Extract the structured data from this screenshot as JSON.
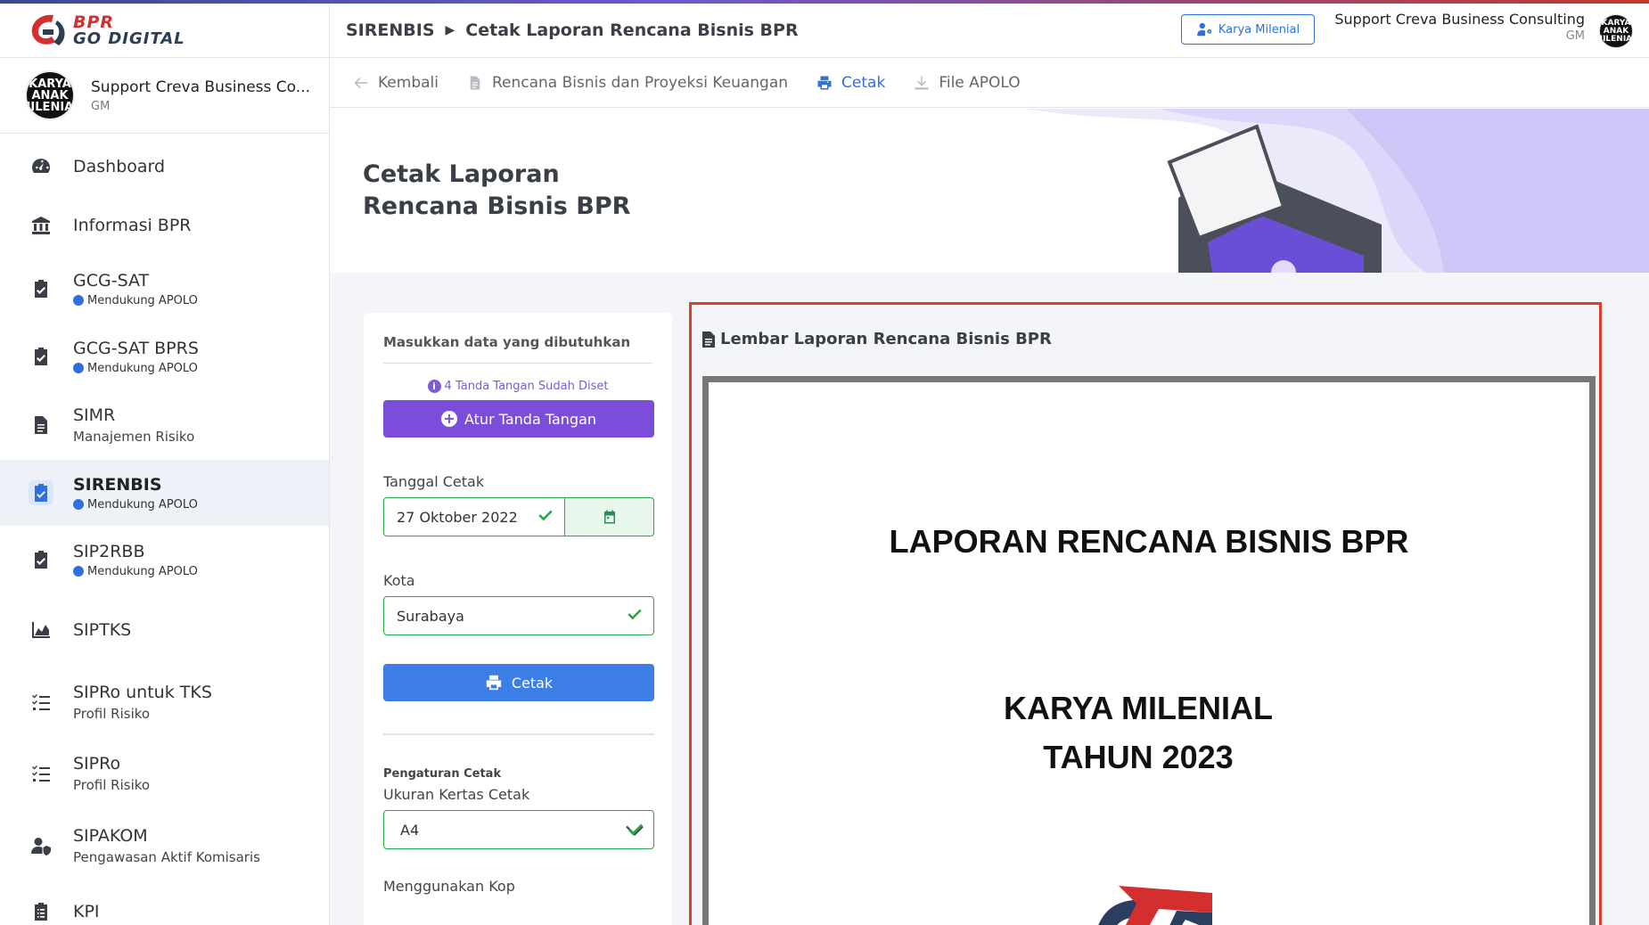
{
  "logo": {
    "line1": "BPR",
    "line2": "GO DIGITAL"
  },
  "user": {
    "name": "Support Creva Business Co...",
    "role": "GM",
    "avatar_text": "KARYA ANAK MILENIAL"
  },
  "menu": [
    {
      "label": "Dashboard",
      "sub": "",
      "icon": "dashboard-icon"
    },
    {
      "label": "Informasi BPR",
      "sub": "",
      "icon": "bank-icon"
    },
    {
      "label": "GCG-SAT",
      "sub": "Mendukung APOLO",
      "icon": "clipboard-check-icon"
    },
    {
      "label": "GCG-SAT BPRS",
      "sub": "Mendukung APOLO",
      "icon": "clipboard-check-icon"
    },
    {
      "label": "SIMR",
      "sub": "Manajemen Risiko",
      "icon": "document-icon"
    },
    {
      "label": "SIRENBIS",
      "sub": "Mendukung APOLO",
      "icon": "clipboard-check-icon"
    },
    {
      "label": "SIP2RBB",
      "sub": "Mendukung APOLO",
      "icon": "clipboard-check-icon"
    },
    {
      "label": "SIPTKS",
      "sub": "",
      "icon": "area-chart-icon"
    },
    {
      "label": "SIPRo untuk TKS",
      "sub": "Profil Risiko",
      "icon": "task-list-icon"
    },
    {
      "label": "SIPRo",
      "sub": "Profil Risiko",
      "icon": "task-list-icon"
    },
    {
      "label": "SIPAKOM",
      "sub": "Pengawasan Aktif Komisaris",
      "icon": "user-shield-icon"
    },
    {
      "label": "KPI",
      "sub": "",
      "icon": "clipboard-list-icon"
    }
  ],
  "breadcrumb": {
    "section": "SIRENBIS",
    "page": "Cetak Laporan Rencana Bisnis BPR"
  },
  "topbar": {
    "karya_button": "Karya Milenial",
    "user_name": "Support Creva Business Consulting",
    "user_role": "GM",
    "avatar_text": "KARYA ANAK MILENIAL"
  },
  "actions": {
    "back": "Kembali",
    "plan": "Rencana Bisnis dan Proyeksi Keuangan",
    "print": "Cetak",
    "file": "File APOLO"
  },
  "hero": {
    "title_line1": "Cetak Laporan",
    "title_line2": "Rencana Bisnis BPR"
  },
  "form": {
    "heading": "Masukkan data yang dibutuhkan",
    "signature_note": "4 Tanda Tangan Sudah Diset",
    "signature_button": "Atur Tanda Tangan",
    "date_label": "Tanggal Cetak",
    "date_value": "27 Oktober 2022",
    "city_label": "Kota",
    "city_value": "Surabaya",
    "print_button": "Cetak",
    "settings_label": "Pengaturan Cetak",
    "paper_label": "Ukuran Kertas Cetak",
    "paper_value": "A4",
    "kop_label": "Menggunakan Kop"
  },
  "preview": {
    "title": "Lembar Laporan Rencana Bisnis BPR",
    "doc_title": "LAPORAN RENCANA BISNIS BPR",
    "company": "KARYA MILENIAL",
    "year": "TAHUN 2023"
  },
  "colors": {
    "primary": "#3c7ee6",
    "purple": "#7c4ddb",
    "success": "#28a745",
    "highlight": "#e0402a",
    "active_bg": "#eef1f7"
  }
}
